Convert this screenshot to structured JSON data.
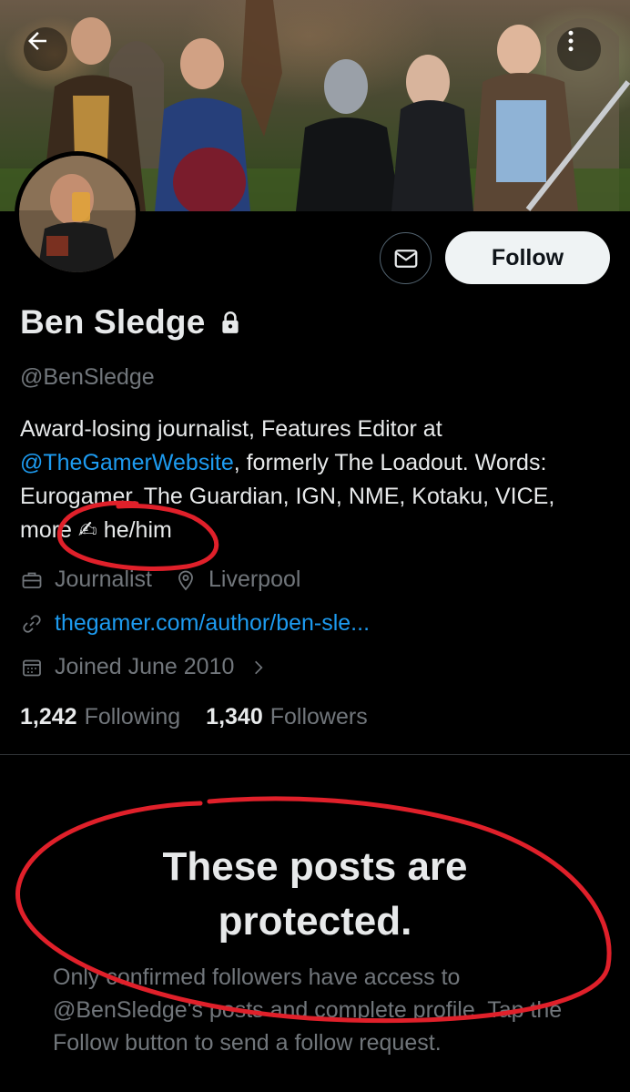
{
  "profile": {
    "name": "Ben Sledge",
    "handle": "@BenSledge",
    "bio_part1": "Award-losing journalist, Features Editor at",
    "bio_mention": "@TheGamerWebsite",
    "bio_part2": ", formerly The Loadout. Words: Eurogamer, The Guardian, IGN, NME, Kotaku, VICE, more ✍ he/him",
    "profession": "Journalist",
    "location": "Liverpool",
    "link": "thegamer.com/author/ben-sle...",
    "joined": "Joined June 2010"
  },
  "stats": {
    "following_count": "1,242",
    "following_label": "Following",
    "followers_count": "1,340",
    "followers_label": "Followers"
  },
  "actions": {
    "follow_label": "Follow"
  },
  "protected": {
    "title_line1": "These posts are",
    "title_line2": "protected.",
    "description": "Only confirmed followers have access to @BenSledge's posts and complete profile. Tap the Follow button to send a follow request."
  },
  "colors": {
    "accent": "#1d9bf0",
    "annotation": "#e0202a"
  },
  "icons": [
    "back-arrow-icon",
    "more-vertical-icon",
    "mail-icon",
    "lock-icon",
    "briefcase-icon",
    "location-pin-icon",
    "link-icon",
    "calendar-icon",
    "chevron-right-icon"
  ]
}
